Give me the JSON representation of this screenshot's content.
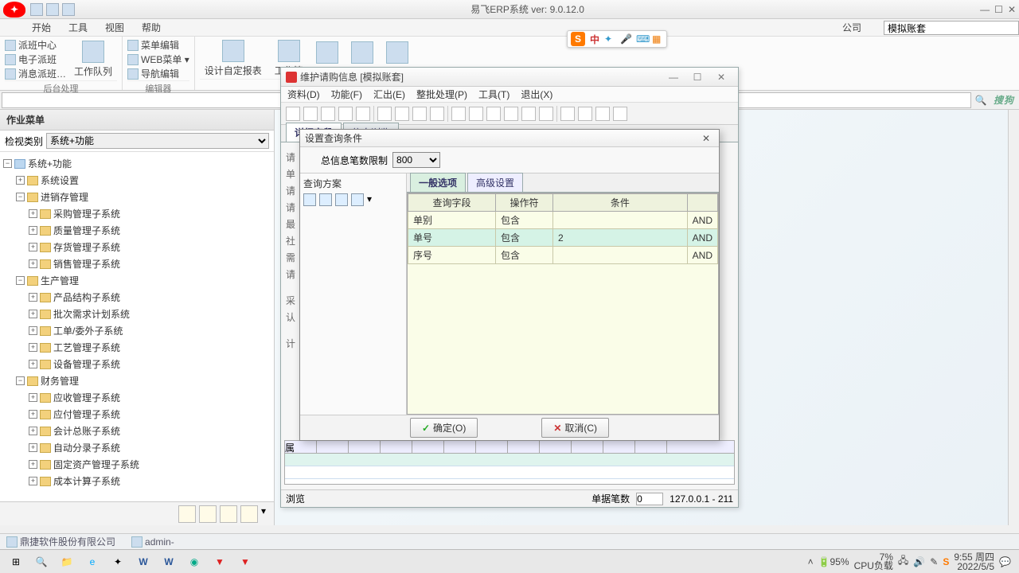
{
  "app": {
    "title": "易飞ERP系统 ver: 9.0.12.0"
  },
  "menu": {
    "start": "开始",
    "tools": "工具",
    "view": "视图",
    "help": "帮助",
    "company_lbl": "公司",
    "company_val": "模拟账套"
  },
  "ime": {
    "cn": "中"
  },
  "ribbon": {
    "g1": {
      "a": "派班中心",
      "b": "电子派班",
      "c": "消息派班…",
      "big": "工作队列",
      "caption": "后台处理"
    },
    "g2": {
      "a": "菜单编辑",
      "b": "WEB菜单 ▾",
      "c": "导航编辑",
      "caption": "编辑器"
    },
    "g3": {
      "a": "设计自定报表",
      "b": "工作管"
    }
  },
  "leftpanel": {
    "header": "作业菜单",
    "filter_lbl": "检视类别",
    "filter_val": "系统+功能",
    "tree": {
      "root": "系统+功能",
      "n1": "系统设置",
      "n2": "进销存管理",
      "n2a": "采购管理子系统",
      "n2b": "质量管理子系统",
      "n2c": "存货管理子系统",
      "n2d": "销售管理子系统",
      "n3": "生产管理",
      "n3a": "产品结构子系统",
      "n3b": "批次需求计划系统",
      "n3c": "工单/委外子系统",
      "n3d": "工艺管理子系统",
      "n3e": "设备管理子系统",
      "n4": "财务管理",
      "n4a": "应收管理子系统",
      "n4b": "应付管理子系统",
      "n4c": "会计总账子系统",
      "n4d": "自动分录子系统",
      "n4e": "固定资产管理子系统",
      "n4f": "成本计算子系统"
    }
  },
  "child": {
    "title": "维护请购信息 [模拟账套]",
    "menu": {
      "a": "资料(D)",
      "b": "功能(F)",
      "c": "汇出(E)",
      "d": "整批处理(P)",
      "e": "工具(T)",
      "f": "退出(X)"
    },
    "tabs": {
      "a": "详细字段",
      "b": "信息浏览"
    },
    "status": {
      "browse": "浏览",
      "count_lbl": "单据笔数",
      "count_val": "0",
      "conn": "127.0.0.1 - 211"
    }
  },
  "dialog": {
    "title": "设置查询条件",
    "limit_lbl": "总信息笔数限制",
    "limit_val": "800",
    "plan_lbl": "查询方案",
    "tabs": {
      "a": "一般选项",
      "b": "高级设置"
    },
    "grid": {
      "h1": "查询字段",
      "h2": "操作符",
      "h3": "条件",
      "h4": "",
      "r1": {
        "f": "单别",
        "op": "包含",
        "c": "",
        "j": "AND"
      },
      "r2": {
        "f": "单号",
        "op": "包含",
        "c": "2",
        "j": "AND"
      },
      "r3": {
        "f": "序号",
        "op": "包含",
        "c": "",
        "j": "AND"
      }
    },
    "ok": "确定(O)",
    "cancel": "取消(C)"
  },
  "appstatus": {
    "company": "鼎捷软件股份有限公司",
    "user": "admin-"
  },
  "taskbar": {
    "battery": "95%",
    "cpu1": "7%",
    "cpu2": "CPU负载",
    "time": "9:55 周四",
    "date": "2022/5/5"
  }
}
